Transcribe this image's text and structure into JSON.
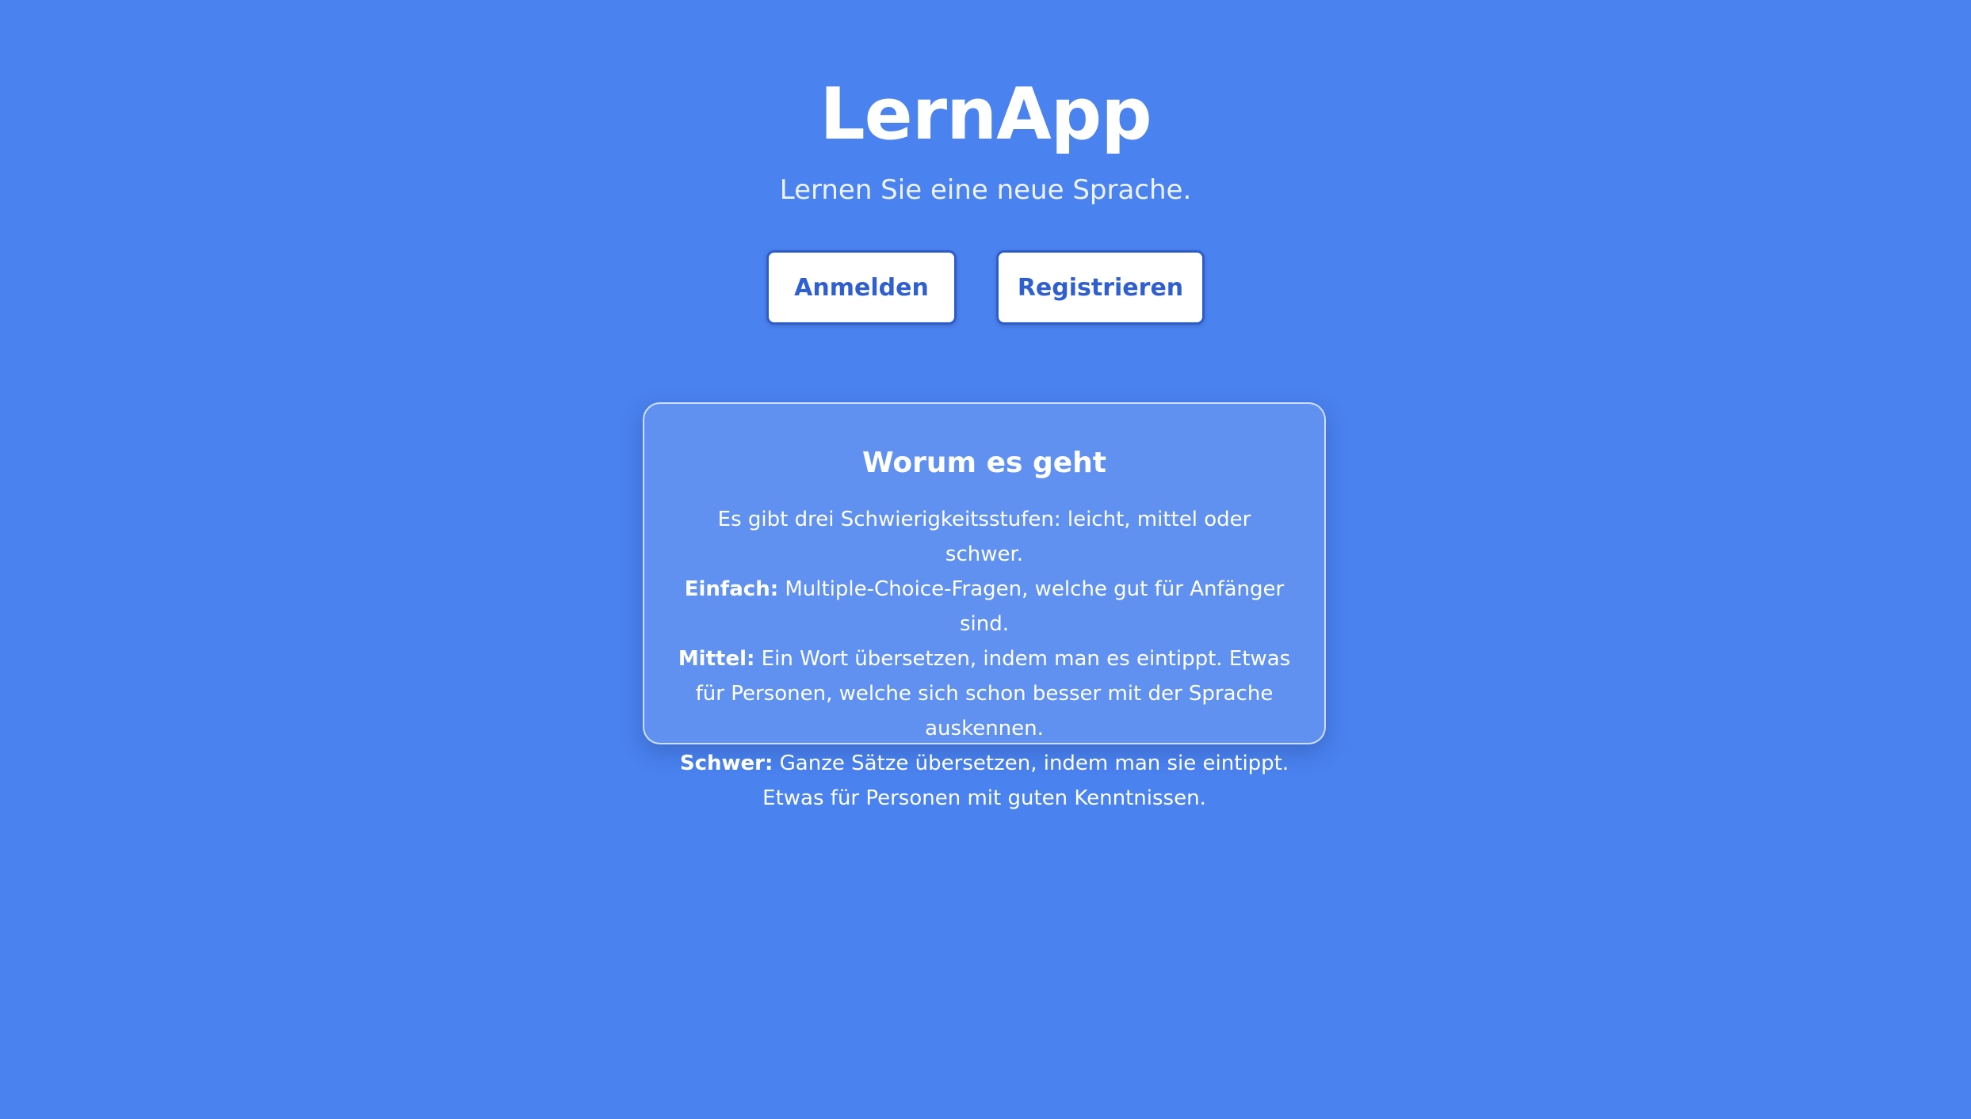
{
  "header": {
    "title": "LernApp",
    "subtitle": "Lernen Sie eine neue Sprache."
  },
  "actions": {
    "login_label": "Anmelden",
    "register_label": "Registrieren"
  },
  "info": {
    "title": "Worum es geht",
    "intro": "Es gibt drei Schwierigkeitsstufen: leicht, mittel oder schwer.",
    "levels": [
      {
        "name": "Einfach:",
        "text": "Multiple-Choice-Fragen, welche gut für Anfänger sind."
      },
      {
        "name": "Mittel:",
        "text": "Ein Wort übersetzen, indem man es eintippt. Etwas für Personen, welche sich schon besser mit der Sprache auskennen."
      },
      {
        "name": "Schwer:",
        "text": "Ganze Sätze übersetzen, indem man sie eintippt. Etwas für Personen mit guten Kenntnissen."
      }
    ]
  },
  "colors": {
    "background": "#4a82ef",
    "button_text": "#2f5fd0",
    "button_border": "#2e5cc9",
    "text": "#ffffff"
  }
}
